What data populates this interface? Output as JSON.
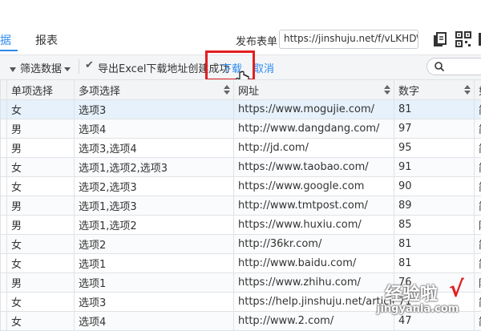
{
  "header": {
    "tabs": [
      {
        "label": "据",
        "active": true
      },
      {
        "label": "报表",
        "active": false
      }
    ],
    "publish_label": "发布表单",
    "publish_url": "https://jinshuju.net/f/vLKHD\\",
    "icons": [
      "copy-icon",
      "qr-code-icon",
      "more-icon"
    ]
  },
  "toolbar": {
    "filter_label": "筛选数据",
    "export_message": "导出Excel下载地址创建成功",
    "download_label": "下载",
    "cancel_label": "取消"
  },
  "table": {
    "columns": [
      "单项选择",
      "多项选择",
      "网址",
      "数字",
      "如"
    ],
    "rows": [
      {
        "gender": "女",
        "multi": "选项3",
        "url": "https://www.mogujie.com/",
        "num": "81",
        "extra": "简",
        "selected": true
      },
      {
        "gender": "男",
        "multi": "选项4",
        "url": "http://www.dangdang.com/",
        "num": "97",
        "extra": "简"
      },
      {
        "gender": "男",
        "multi": "选项3,选项4",
        "url": "http://jd.com/",
        "num": "95",
        "extra": "简"
      },
      {
        "gender": "女",
        "multi": "选项1,选项2,选项3",
        "url": "https://www.taobao.com/",
        "num": "91",
        "extra": "简"
      },
      {
        "gender": "女",
        "multi": "选项2,选项3",
        "url": "https://www.google.com",
        "num": "90",
        "extra": "简"
      },
      {
        "gender": "男",
        "multi": "选项1,选项3",
        "url": "http://www.tmtpost.com/",
        "num": "89",
        "extra": "简"
      },
      {
        "gender": "男",
        "multi": "选项1,选项2",
        "url": "https://www.huxiu.com/",
        "num": "85",
        "extra": "阿"
      },
      {
        "gender": "女",
        "multi": "选项2",
        "url": "http://36kr.com/",
        "num": "81",
        "extra": "简"
      },
      {
        "gender": "女",
        "multi": "选项1",
        "url": "http://www.baidu.com/",
        "num": "81",
        "extra": "简"
      },
      {
        "gender": "男",
        "multi": "选项1",
        "url": "https://www.zhihu.com/",
        "num": "76",
        "extra": "阿"
      },
      {
        "gender": "女",
        "multi": "选项3",
        "url": "https://help.jinshuju.net/article",
        "num": "71",
        "extra": "简"
      },
      {
        "gender": "女",
        "multi": "选项4",
        "url": "http://www.2.com/",
        "num": "47",
        "extra": "简"
      }
    ]
  },
  "watermark": {
    "title": "经验啦",
    "check": "√",
    "url": "jingyanla.com"
  }
}
